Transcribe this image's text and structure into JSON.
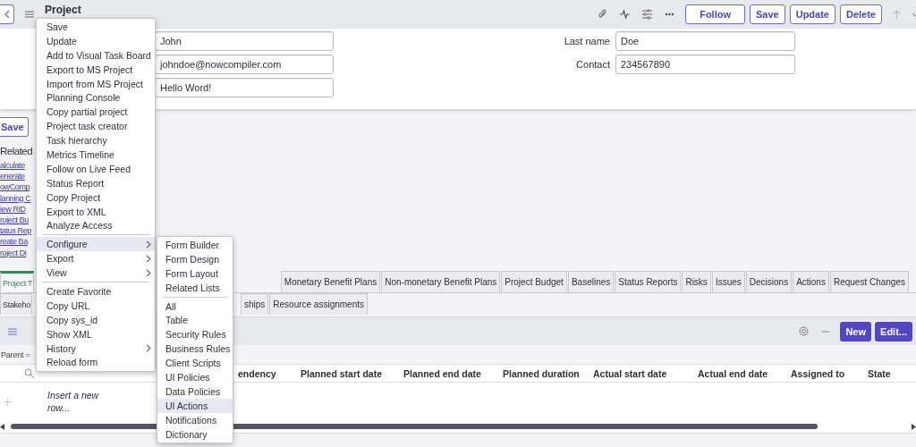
{
  "header": {
    "title": "Project",
    "buttons": [
      "Follow",
      "Save",
      "Update",
      "Delete"
    ]
  },
  "form": {
    "left_fields": [
      {
        "value": "John"
      },
      {
        "value": "johndoe@nowcompiler.com"
      },
      {
        "value": "Hello Word!"
      }
    ],
    "right_fields": [
      {
        "label": "Last name",
        "value": "Doe"
      },
      {
        "label": "Contact",
        "value": "234567890"
      }
    ]
  },
  "left_panel": {
    "save_button": "Save",
    "heading": "Related",
    "links": [
      "alculate",
      "enerate",
      "owComp",
      "lanning C",
      "iew RID",
      "roject Bu",
      "tatus Rep",
      "reate Ba",
      "roject Di"
    ]
  },
  "tabs_row1": [
    {
      "label": "Project T",
      "selected": true
    },
    {
      "label": "Monetary Benefit Plans",
      "selected": false
    },
    {
      "label": "Non-monetary Benefit Plans",
      "selected": false
    },
    {
      "label": "Project Budget",
      "selected": false
    },
    {
      "label": "Baselines",
      "selected": false
    },
    {
      "label": "Status Reports",
      "selected": false
    },
    {
      "label": "Risks",
      "selected": false
    },
    {
      "label": "Issues",
      "selected": false
    },
    {
      "label": "Decisions",
      "selected": false
    },
    {
      "label": "Actions",
      "selected": false
    },
    {
      "label": "Request Changes",
      "selected": false
    }
  ],
  "tabs_row2": [
    {
      "label": "Stakeho",
      "selected": false
    },
    {
      "label": "ships",
      "selected": false
    },
    {
      "label": "Resource assignments",
      "selected": false
    }
  ],
  "related_list": {
    "buttons": [
      "New",
      "Edit..."
    ],
    "filter": "Parent =",
    "columns": [
      "endency",
      "Planned start date",
      "Planned end date",
      "Planned duration",
      "Actual start date",
      "Actual end date",
      "Assigned to",
      "State"
    ],
    "insert_row": "Insert a new row..."
  },
  "context_menu": {
    "items": [
      {
        "label": "Save",
        "selected": false,
        "submenu": false,
        "separator": false
      },
      {
        "label": "Update",
        "selected": false,
        "submenu": false,
        "separator": false
      },
      {
        "label": "Add to Visual Task Board",
        "selected": false,
        "submenu": false,
        "separator": false
      },
      {
        "label": "Export to MS Project",
        "selected": false,
        "submenu": false,
        "separator": false
      },
      {
        "label": "Import from MS Project",
        "selected": false,
        "submenu": false,
        "separator": false
      },
      {
        "label": "Planning Console",
        "selected": false,
        "submenu": false,
        "separator": false
      },
      {
        "label": "Copy partial project",
        "selected": false,
        "submenu": false,
        "separator": false
      },
      {
        "label": "Project task creator",
        "selected": false,
        "submenu": false,
        "separator": false
      },
      {
        "label": "Task hierarchy",
        "selected": false,
        "submenu": false,
        "separator": false
      },
      {
        "label": "Metrics Timeline",
        "selected": false,
        "submenu": false,
        "separator": false
      },
      {
        "label": "Follow on Live Feed",
        "selected": false,
        "submenu": false,
        "separator": false
      },
      {
        "label": "Status Report",
        "selected": false,
        "submenu": false,
        "separator": false
      },
      {
        "label": "Copy Project",
        "selected": false,
        "submenu": false,
        "separator": false
      },
      {
        "label": "Export to XML",
        "selected": false,
        "submenu": false,
        "separator": false
      },
      {
        "label": "Analyze Access",
        "selected": false,
        "submenu": false,
        "separator": false
      },
      {
        "label": "Configure",
        "selected": true,
        "submenu": true,
        "separator": true
      },
      {
        "label": "Export",
        "selected": false,
        "submenu": true,
        "separator": false
      },
      {
        "label": "View",
        "selected": false,
        "submenu": true,
        "separator": false
      },
      {
        "label": "Create Favorite",
        "selected": false,
        "submenu": false,
        "separator": true
      },
      {
        "label": "Copy URL",
        "selected": false,
        "submenu": false,
        "separator": false
      },
      {
        "label": "Copy sys_id",
        "selected": false,
        "submenu": false,
        "separator": false
      },
      {
        "label": "Show XML",
        "selected": false,
        "submenu": false,
        "separator": false
      },
      {
        "label": "History",
        "selected": false,
        "submenu": true,
        "separator": false
      },
      {
        "label": "Reload form",
        "selected": false,
        "submenu": false,
        "separator": false
      }
    ]
  },
  "submenu": {
    "items": [
      {
        "label": "Form Builder",
        "selected": false,
        "separator": false
      },
      {
        "label": "Form Design",
        "selected": false,
        "separator": false
      },
      {
        "label": "Form Layout",
        "selected": false,
        "separator": false
      },
      {
        "label": "Related Lists",
        "selected": false,
        "separator": false
      },
      {
        "label": "All",
        "selected": false,
        "separator": true
      },
      {
        "label": "Table",
        "selected": false,
        "separator": false
      },
      {
        "label": "Security Rules",
        "selected": false,
        "separator": false
      },
      {
        "label": "Business Rules",
        "selected": false,
        "separator": false
      },
      {
        "label": "Client Scripts",
        "selected": false,
        "separator": false
      },
      {
        "label": "UI Policies",
        "selected": false,
        "separator": false
      },
      {
        "label": "Data Policies",
        "selected": false,
        "separator": false
      },
      {
        "label": "UI Actions",
        "selected": true,
        "separator": false
      },
      {
        "label": "Notifications",
        "selected": false,
        "separator": false
      },
      {
        "label": "Dictionary",
        "selected": false,
        "separator": false
      }
    ]
  }
}
